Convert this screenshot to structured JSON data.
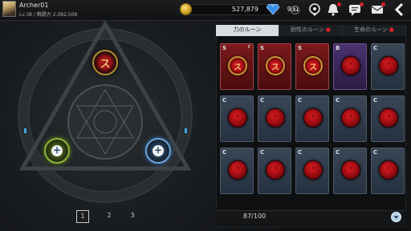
{
  "player": {
    "name": "Archer01",
    "stats": "Lv.38 / 戦闘力 2,082,508"
  },
  "currency": {
    "gold": "527,879",
    "gems": "931"
  },
  "icons": [
    "coin-icon",
    "gem-icon",
    "plus-icon",
    "quest-icon",
    "bell-icon",
    "chat-icon",
    "mail-icon",
    "back-icon"
  ],
  "rune_tabs": [
    {
      "label": "力のルーン",
      "active": true
    },
    {
      "label": "耐性のルーン",
      "active": false
    },
    {
      "label": "生命のルーン",
      "active": false
    }
  ],
  "rune_cards": [
    {
      "rank": "S",
      "sub": "E",
      "style": "s",
      "glyph": "ス"
    },
    {
      "rank": "S",
      "sub": "",
      "style": "s",
      "glyph": "ス"
    },
    {
      "rank": "S",
      "sub": "",
      "style": "s",
      "glyph": "ス"
    },
    {
      "rank": "B",
      "sub": "",
      "style": "b",
      "glyph": ""
    },
    {
      "rank": "C",
      "sub": "",
      "style": "c",
      "glyph": ""
    },
    {
      "rank": "C",
      "sub": "",
      "style": "c",
      "glyph": ""
    },
    {
      "rank": "C",
      "sub": "",
      "style": "c",
      "glyph": ""
    },
    {
      "rank": "C",
      "sub": "",
      "style": "c",
      "glyph": ""
    },
    {
      "rank": "C",
      "sub": "",
      "style": "c",
      "glyph": ""
    },
    {
      "rank": "C",
      "sub": "",
      "style": "c",
      "glyph": ""
    },
    {
      "rank": "C",
      "sub": "",
      "style": "c",
      "glyph": ""
    },
    {
      "rank": "C",
      "sub": "",
      "style": "c",
      "glyph": ""
    },
    {
      "rank": "C",
      "sub": "",
      "style": "c",
      "glyph": ""
    },
    {
      "rank": "C",
      "sub": "",
      "style": "c",
      "glyph": ""
    },
    {
      "rank": "C",
      "sub": "",
      "style": "c",
      "glyph": ""
    }
  ],
  "inventory_count": "87/100",
  "pages": [
    "1",
    "2",
    "3"
  ],
  "active_page": "1",
  "colors": {
    "accent_red": "#d8202a",
    "card_s": "#7c1a1c",
    "card_b": "#4b3270",
    "card_c": "#2f3b4b"
  }
}
